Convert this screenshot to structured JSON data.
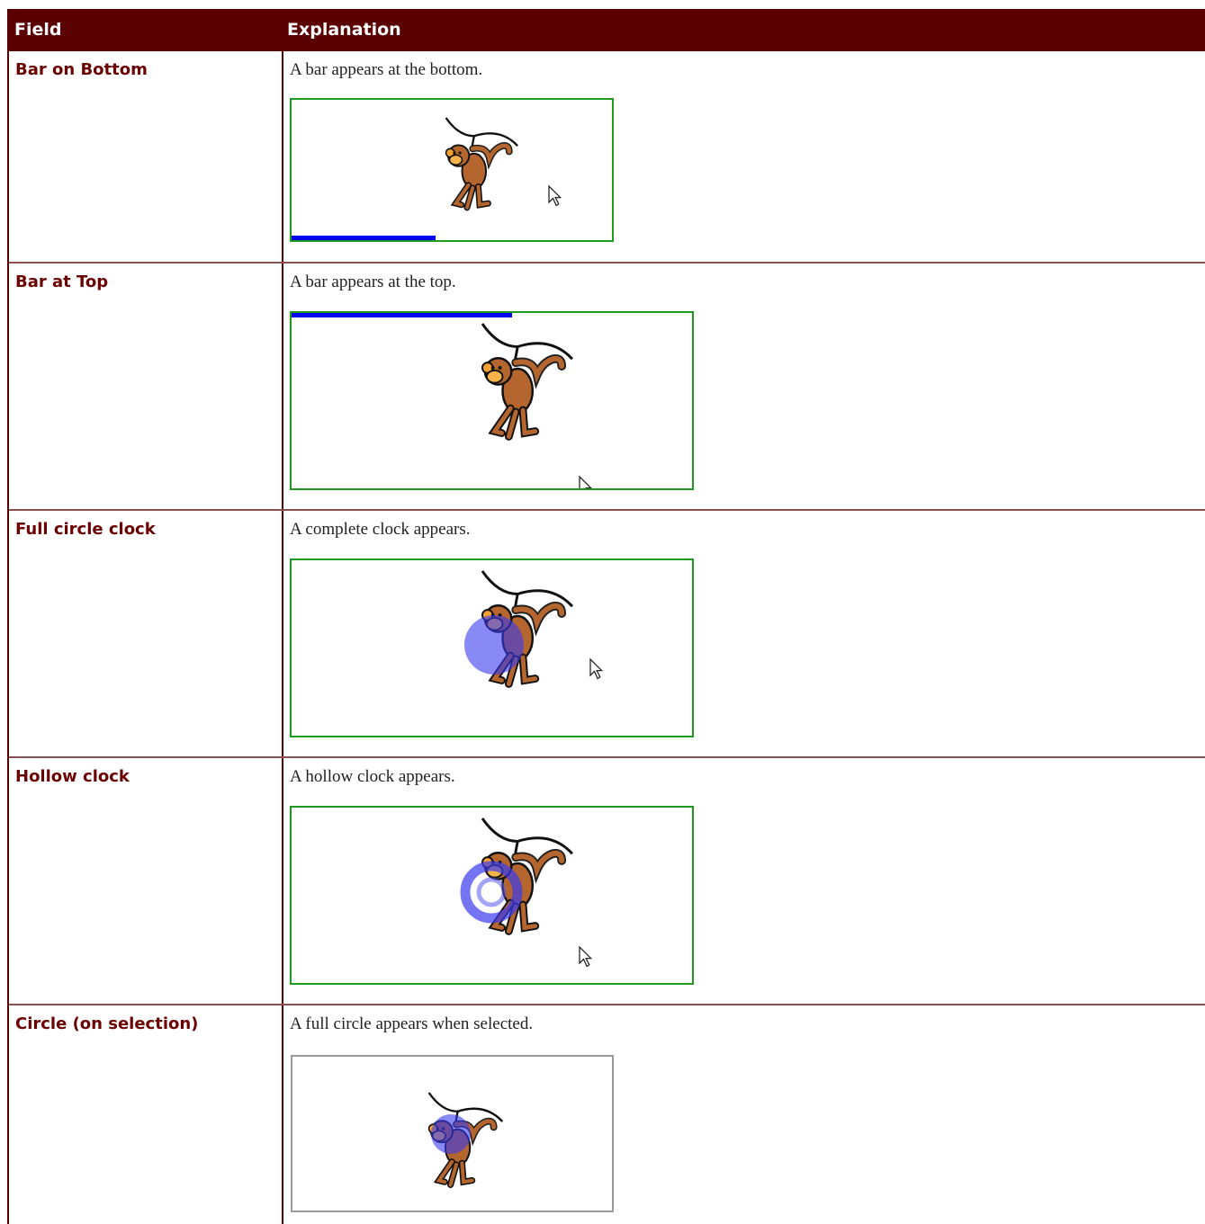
{
  "table": {
    "headers": {
      "field": "Field",
      "explanation": "Explanation"
    },
    "rows": [
      {
        "field": "Bar on Bottom",
        "explanation": "A bar appears at the bottom.",
        "indicator": "bar-bottom",
        "progress": 0.45
      },
      {
        "field": "Bar at Top",
        "explanation": "A bar appears at the top.",
        "indicator": "bar-top",
        "progress": 0.55
      },
      {
        "field": "Full circle clock",
        "explanation": "A complete clock appears.",
        "indicator": "full-circle-clock"
      },
      {
        "field": "Hollow clock",
        "explanation": "A hollow clock appears.",
        "indicator": "hollow-clock"
      },
      {
        "field": "Circle (on selection)",
        "explanation": "A full circle appears when selected.",
        "indicator": "circle-selection"
      }
    ]
  },
  "colors": {
    "header_bg": "#5a0000",
    "field_text": "#6b0000",
    "frame_green": "#1e9a1e",
    "frame_gray": "#9a9a9a",
    "indicator_blue": "#0000ee"
  }
}
